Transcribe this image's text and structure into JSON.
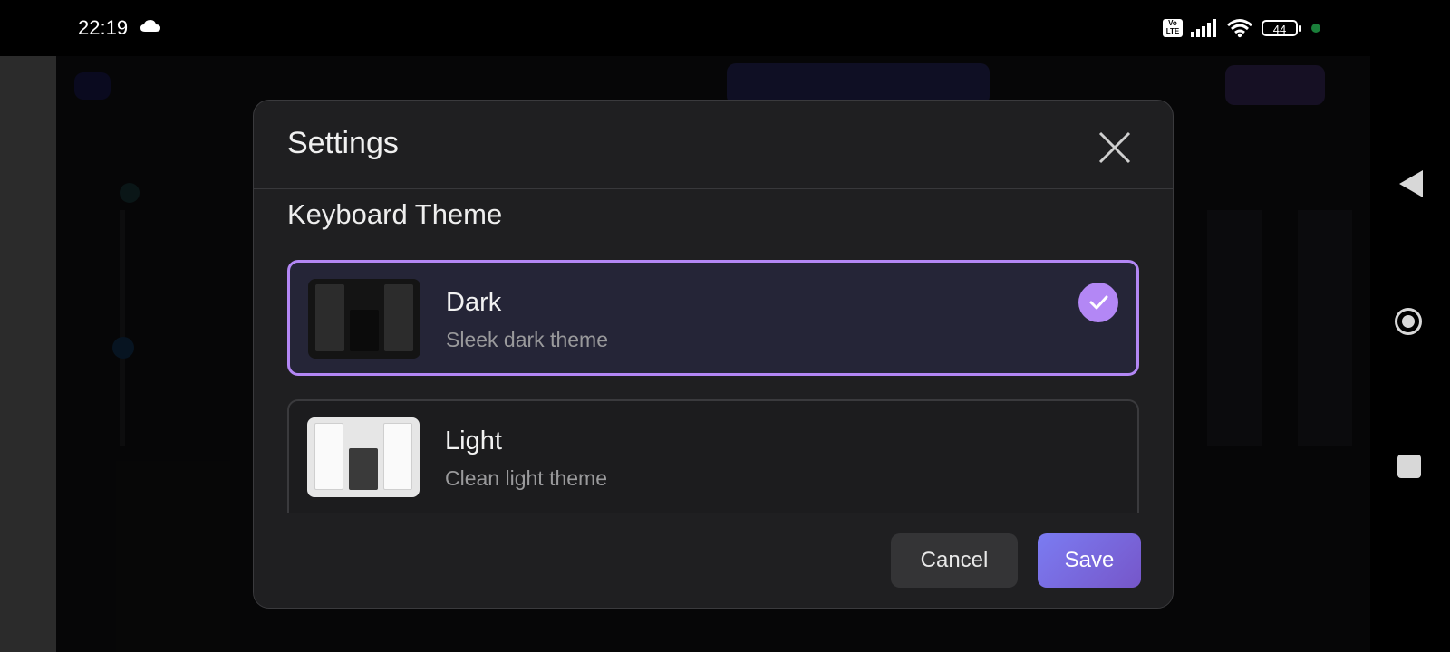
{
  "status_bar": {
    "time": "22:19",
    "volte_label": "Vo\nLTE",
    "battery": "44",
    "icons": [
      "cloud-icon",
      "volte-icon",
      "signal-icon",
      "wifi-icon",
      "battery-icon",
      "privacy-dot-icon"
    ]
  },
  "dialog": {
    "title": "Settings",
    "close_icon": "close-icon",
    "section_title": "Keyboard Theme",
    "options": [
      {
        "name": "Dark",
        "description": "Sleek dark theme",
        "selected": true,
        "check_icon": "check-icon"
      },
      {
        "name": "Light",
        "description": "Clean light theme",
        "selected": false
      }
    ],
    "cancel_label": "Cancel",
    "save_label": "Save"
  },
  "nav_bar": {
    "icons": [
      "back-icon",
      "home-icon",
      "recents-icon"
    ]
  },
  "colors": {
    "accent": "#b387f5",
    "save_gradient_start": "#7b7cf2",
    "save_gradient_end": "#7656c9",
    "dialog_bg": "#1f1f21"
  }
}
